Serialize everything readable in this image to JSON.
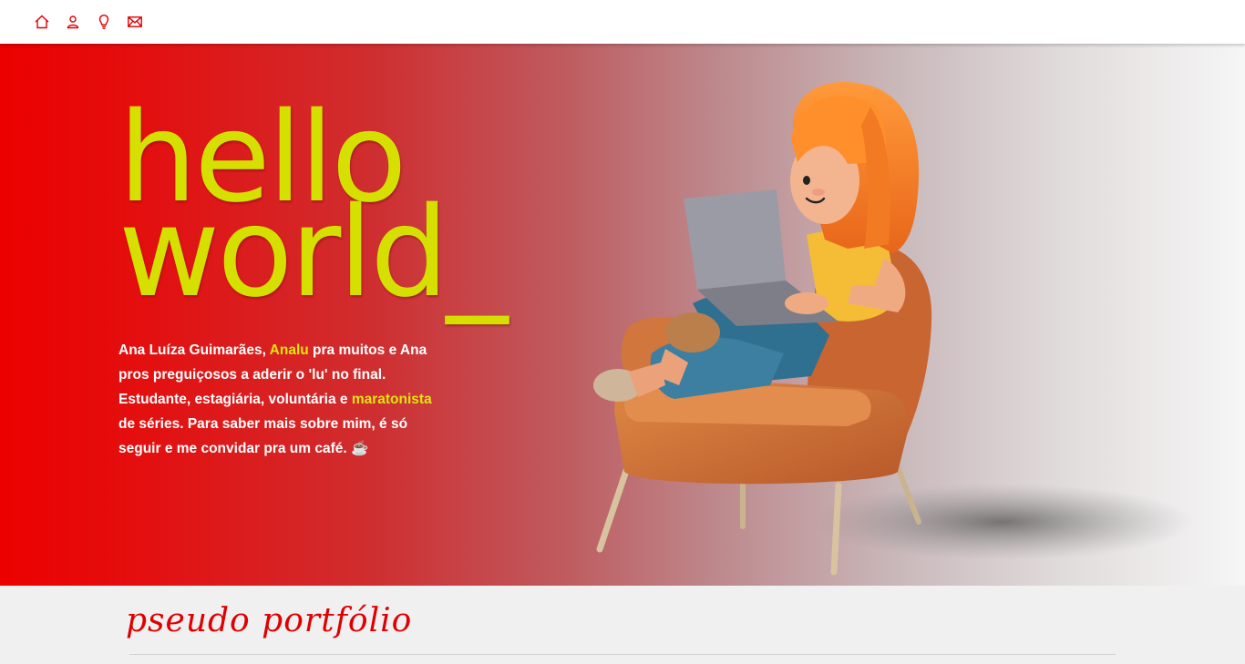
{
  "nav": {
    "icons": [
      "home-icon",
      "user-icon",
      "lightbulb-icon",
      "mail-icon"
    ],
    "accent": "#e00000"
  },
  "hero": {
    "headline_line1": "hello",
    "headline_line2": "world_",
    "bio": {
      "t1": "Ana Luíza Guimarães, ",
      "h1": "Analu",
      "t2": " pra muitos e Ana pros preguiçosos a aderir o 'lu' no final. Estudante, estagiária, voluntária e ",
      "h2": "maratonista",
      "t3": " de séries. Para saber mais sobre mim, é só seguir e me convidar pra um café. ☕"
    },
    "headline_color": "#d6e000",
    "gradient_start": "#ec0000",
    "gradient_end": "#f6f6f6"
  },
  "portfolio": {
    "title": "pseudo portfólio"
  }
}
